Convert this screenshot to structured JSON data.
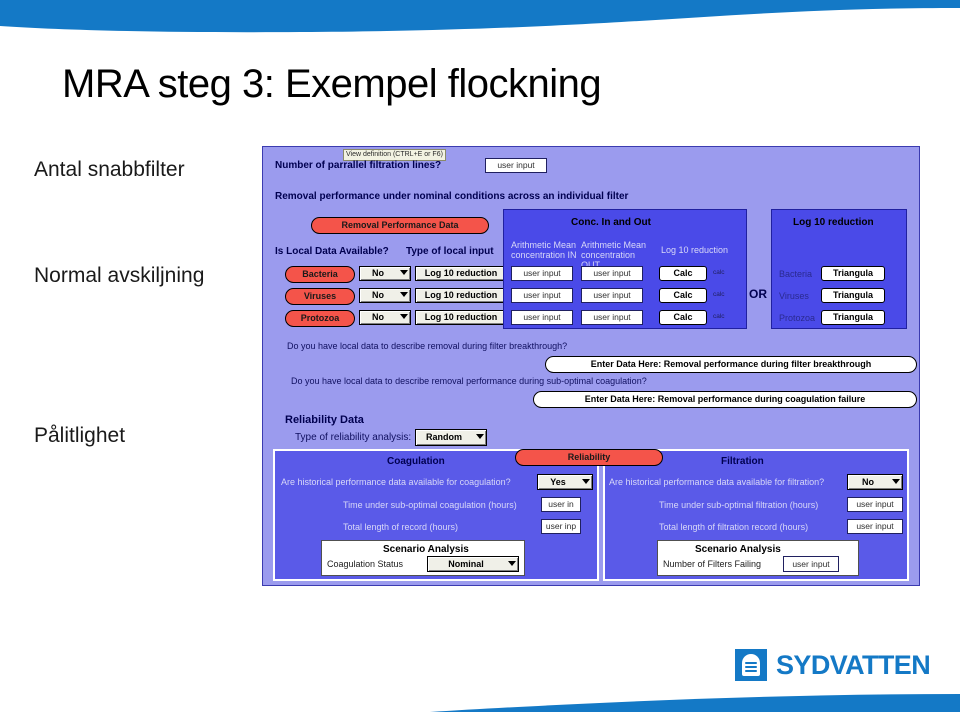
{
  "slide": {
    "title": "MRA steg 3: Exempel flockning",
    "side_labels": [
      {
        "id": "antal",
        "text": "Antal snabbfilter"
      },
      {
        "id": "normal",
        "text": "Normal avskiljning"
      },
      {
        "id": "palitlighet",
        "text": "Pålitlighet"
      }
    ],
    "logo_text": "SYDVATTEN",
    "colors": {
      "brand_blue": "#1479c6",
      "banner_blue": "#1479c6"
    }
  },
  "app": {
    "tooltip": "View definition (CTRL+E or F6)",
    "parallel_lines": {
      "question": "Number of parrallel filtration lines?",
      "input_value": "user input"
    },
    "removal_section": {
      "heading": "Removal performance under nominal conditions across an individual filter",
      "data_button": "Removal Performance Data",
      "col_local_available": "Is Local Data Available?",
      "col_type_of_input": "Type of local input",
      "rows": [
        {
          "organism": "Bacteria",
          "available": "No",
          "input_type": "Log 10 reduction"
        },
        {
          "organism": "Viruses",
          "available": "No",
          "input_type": "Log 10 reduction"
        },
        {
          "organism": "Protozoa",
          "available": "No",
          "input_type": "Log 10 reduction"
        }
      ],
      "conc_panel": {
        "title": "Conc. In and Out",
        "col_in": "Arithmetic Mean concentration IN",
        "col_out": "Arithmetic Mean concentration OUT",
        "col_log": "Log 10 reduction",
        "rows": [
          {
            "in": "user input",
            "out": "user input",
            "calc": "Calc",
            "calc_note": "calc"
          },
          {
            "in": "user input",
            "out": "user input",
            "calc": "Calc",
            "calc_note": "calc"
          },
          {
            "in": "user input",
            "out": "user input",
            "calc": "Calc",
            "calc_note": "calc"
          }
        ]
      },
      "or_label": "OR",
      "log_panel": {
        "title": "Log 10 reduction",
        "rows": [
          {
            "organism": "Bacteria",
            "button": "Triangula"
          },
          {
            "organism": "Viruses",
            "button": "Triangula"
          },
          {
            "organism": "Protozoa",
            "button": "Triangula"
          }
        ]
      }
    },
    "breakthrough": {
      "question": "Do you have local data to describe removal during filter breakthrough?",
      "button": "Enter Data Here: Removal performance during filter breakthrough"
    },
    "suboptimal": {
      "question": "Do you have local data to describe removal performance during sub-optimal coagulation?",
      "button": "Enter Data Here: Removal performance during coagulation failure"
    },
    "reliability": {
      "heading": "Reliability Data",
      "analysis_label": "Type of reliability analysis:",
      "analysis_value": "Random",
      "badge": "Reliability",
      "coagulation": {
        "title": "Coagulation",
        "historical_q": "Are historical performance data available for coagulation?",
        "historical_value": "Yes",
        "time_label": "Time under sub-optimal coagulation (hours)",
        "time_value": "user in",
        "record_label": "Total length of record (hours)",
        "record_value": "user inp",
        "scenario_title": "Scenario Analysis",
        "scenario_label": "Coagulation Status",
        "scenario_value": "Nominal"
      },
      "filtration": {
        "title": "Filtration",
        "historical_q": "Are historical performance data available for filtration?",
        "historical_value": "No",
        "time_label": "Time under sub-optimal filtration (hours)",
        "time_value": "user input",
        "record_label": "Total length of filtration record (hours)",
        "record_value": "user input",
        "scenario_title": "Scenario Analysis",
        "scenario_label": "Number of Filters Failing",
        "scenario_value": "user input"
      }
    }
  }
}
